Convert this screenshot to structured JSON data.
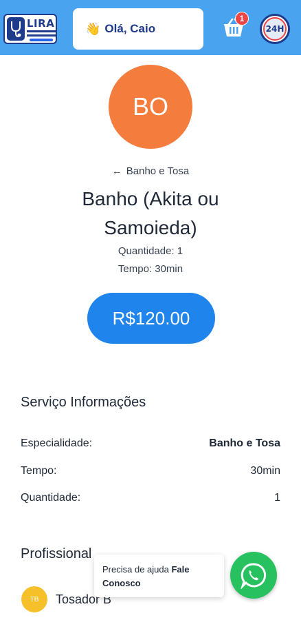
{
  "header": {
    "logo_text": "LIRA",
    "greeting_emoji": "👋",
    "greeting": "Olá, Caio",
    "cart_count": "1",
    "badge_text": "24H"
  },
  "service": {
    "avatar_initials": "BO",
    "back_label": "Banho e Tosa",
    "title": "Banho (Akita ou Samoieda)",
    "quantity": "Quantidade: 1",
    "time": "Tempo: 30min",
    "price": "R$120.00"
  },
  "info": {
    "title": "Serviço Informações",
    "rows": [
      {
        "label": "Especialidade:",
        "value": "Banho e Tosa"
      },
      {
        "label": "Tempo:",
        "value": "30min"
      },
      {
        "label": "Quantidade:",
        "value": "1"
      }
    ]
  },
  "professional": {
    "title": "Profissional",
    "initials": "TB",
    "name": "Tosador B"
  },
  "help": {
    "text": "Precisa de ajuda",
    "link": "Fale Conosco"
  },
  "colors": {
    "header_bg": "#4aa3ee",
    "avatar_bg": "#f47c3c",
    "price_bg": "#1f85ec",
    "whatsapp": "#27c25f",
    "badge_red": "#ef4444",
    "professional_avatar": "#f6c02a"
  },
  "icons": [
    "stethoscope-icon",
    "cart-icon",
    "whatsapp-icon",
    "back-arrow-icon",
    "wave-emoji-icon"
  ]
}
